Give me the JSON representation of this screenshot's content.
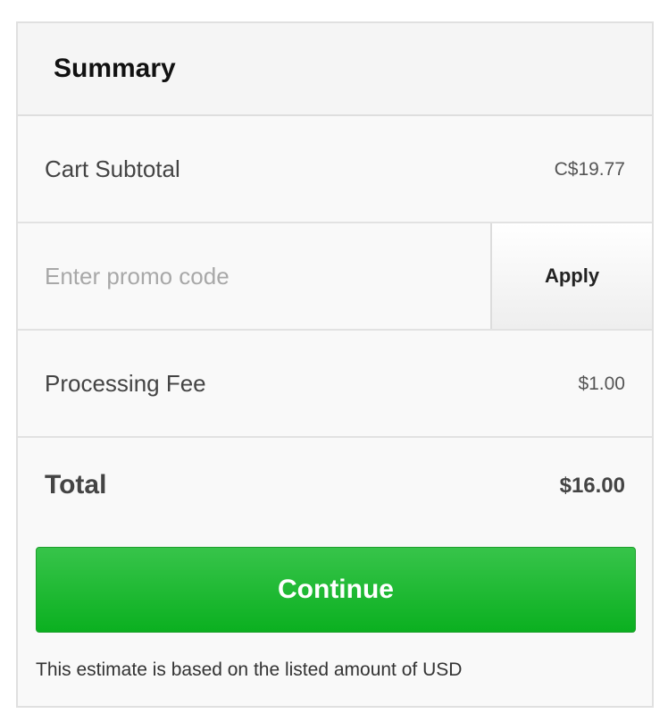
{
  "summary": {
    "title": "Summary"
  },
  "cart_subtotal": {
    "label": "Cart Subtotal",
    "value": "C$19.77"
  },
  "promo": {
    "placeholder": "Enter promo code",
    "value": "",
    "apply_label": "Apply"
  },
  "processing_fee": {
    "label": "Processing Fee",
    "value": "$1.00"
  },
  "total": {
    "label": "Total",
    "value": "$16.00"
  },
  "continue_label": "Continue",
  "footnote": "This estimate is based on the listed amount of USD",
  "colors": {
    "continue_green": "#22bb35",
    "border": "#e0e0e0",
    "text": "#333333"
  }
}
